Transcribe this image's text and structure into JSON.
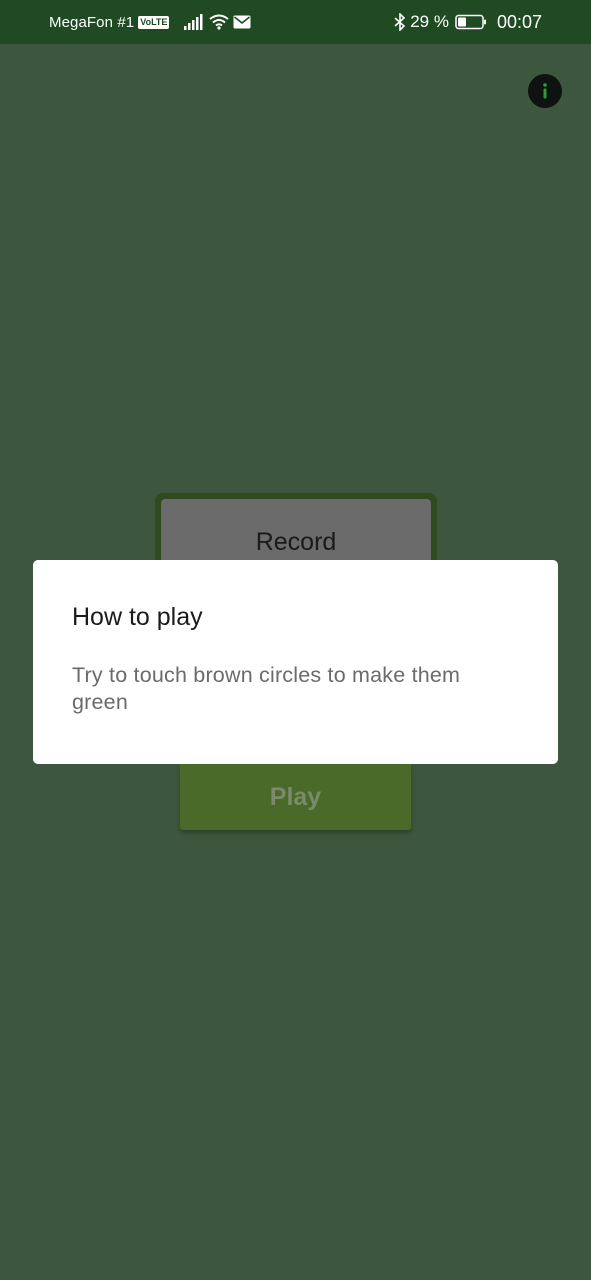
{
  "status_bar": {
    "carrier": "MegaFon #1",
    "volte": "VoLTE",
    "battery_percent": "29 %",
    "time": "00:07"
  },
  "info_button": {
    "icon": "info-icon"
  },
  "record_button": {
    "label": "Record"
  },
  "play_button": {
    "label": "Play"
  },
  "dialog": {
    "title": "How to play",
    "message": "Try to touch brown circles to make them green"
  },
  "colors": {
    "background": "#3c573d",
    "status_bar": "#1f4a22",
    "dialog": "#ffffff"
  }
}
